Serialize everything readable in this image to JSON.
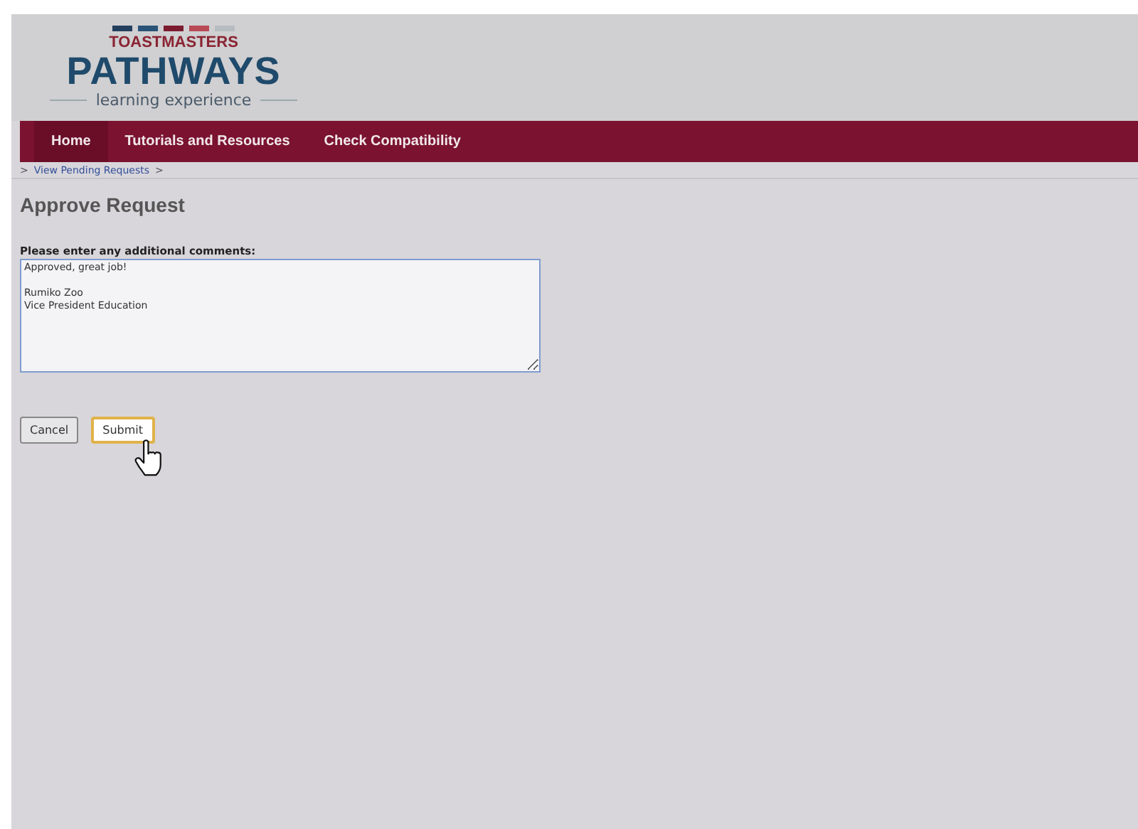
{
  "logo": {
    "overline": "TOASTMASTERS",
    "title": "PATHWAYS",
    "tagline": "learning experience"
  },
  "nav": [
    {
      "label": "Home",
      "selected": true
    },
    {
      "label": "Tutorials and Resources",
      "selected": false
    },
    {
      "label": "Check Compatibility",
      "selected": false
    }
  ],
  "breadcrumb": {
    "lead": ">",
    "items": [
      {
        "label": "View Pending Requests",
        "separator": ">"
      }
    ]
  },
  "page_title": "Approve Request",
  "comments": {
    "label": "Please enter any additional comments:",
    "value": "Approved, great job!\n\nRumiko Zoo\nVice President Education"
  },
  "buttons": [
    {
      "label": "Cancel",
      "focused": false
    },
    {
      "label": "Submit",
      "focused": true
    }
  ]
}
